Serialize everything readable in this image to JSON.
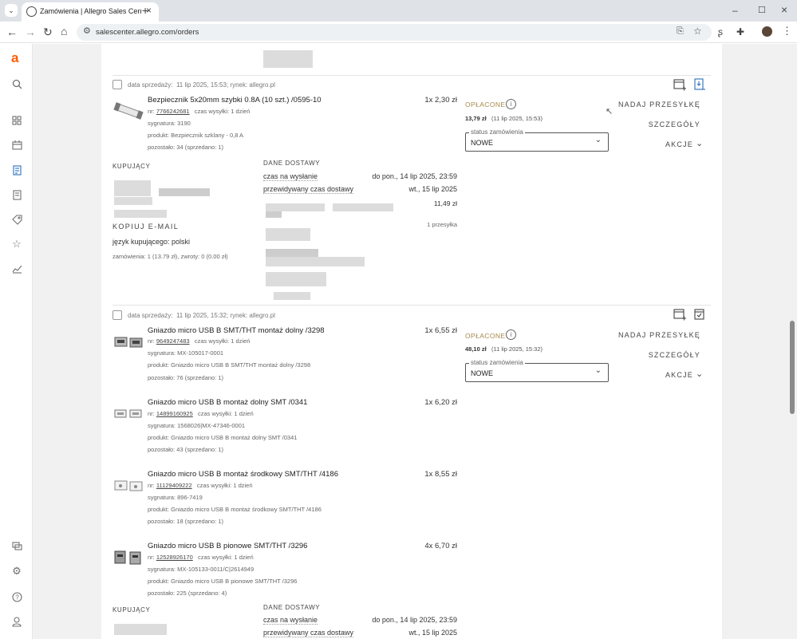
{
  "browser": {
    "tab_title": "Zamówienia | Allegro Sales Center",
    "url": "salescenter.allegro.com/orders"
  },
  "sidebar": {
    "logo": "a",
    "items": [
      "search-icon",
      "dashboard-icon",
      "calendar-icon",
      "orders-icon",
      "catalog-icon",
      "tag-icon",
      "star-icon",
      "stats-icon",
      "messages-icon",
      "settings-icon",
      "help-icon",
      "user-icon"
    ]
  },
  "orders": [
    {
      "sale_date_label": "data sprzedaży:",
      "sale_date": "11 lip 2025, 15:53; rynek: allegro.pl",
      "items": [
        {
          "name": "Bezpiecznik 5x20mm szybki 0.8A (10 szt.) /0595-10",
          "nr_label": "nr:",
          "nr": "7766242681",
          "ship_time": "czas wysyłki: 1 dzień",
          "signature": "sygnatura: 3190",
          "product": "produkt: Bezpiecznik szklany - 0,8 A",
          "remaining": "pozostało: 34 (sprzedano: 1)",
          "qty": "1x 2,30 zł"
        }
      ],
      "payment_status": "OPŁACONE",
      "total": "13,79 zł",
      "total_date": "(11 lip 2025, 15:53)",
      "status_label": "status zamówienia",
      "status_value": "NOWE",
      "actions": [
        "NADAJ PRZESYŁKĘ",
        "SZCZEGÓŁY",
        "AKCJE"
      ],
      "buyer_header": "KUPUJĄCY",
      "copy_email": "KOPIUJ E-MAIL",
      "buyer_language": "język kupującego: polski",
      "buyer_orders": "zamówienia: 1 (13.79 zł), zwroty: 0 (0.00 zł)",
      "delivery_header": "DANE DOSTAWY",
      "ship_by_label": "czas na wysłanie",
      "ship_by_value": "do pon., 14 lip 2025, 23:59",
      "eta_label": "przewidywany czas dostawy",
      "eta_value": "wt., 15 lip 2025",
      "delivery_cost": "11,49 zł",
      "parcels": "1 przesyłka"
    },
    {
      "sale_date_label": "data sprzedaży:",
      "sale_date": "11 lip 2025, 15:32; rynek: allegro.pl",
      "items": [
        {
          "name": "Gniazdo micro USB B SMT/THT montaż dolny /3298",
          "nr_label": "nr:",
          "nr": "9649247483",
          "ship_time": "czas wysyłki: 1 dzień",
          "signature": "sygnatura: MX-105017-0001",
          "product": "produkt: Gniazdo micro USB B SMT/THT montaż dolny /3298",
          "remaining": "pozostało: 76 (sprzedano: 1)",
          "qty": "1x 6,55 zł"
        },
        {
          "name": "Gniazdo micro USB B montaż dolny SMT /0341",
          "nr_label": "nr:",
          "nr": "14899160925",
          "ship_time": "czas wysyłki: 1 dzień",
          "signature": "sygnatura: 1568026|MX-47346-0001",
          "product": "produkt: Gniazdo micro USB B montaż dolny SMT /0341",
          "remaining": "pozostało: 43 (sprzedano: 1)",
          "qty": "1x 6,20 zł"
        },
        {
          "name": "Gniazdo micro USB B montaż środkowy SMT/THT /4186",
          "nr_label": "nr:",
          "nr": "11129409222",
          "ship_time": "czas wysyłki: 1 dzień",
          "signature": "sygnatura: 896-7419",
          "product": "produkt: Gniazdo micro USB B montaż środkowy SMT/THT /4186",
          "remaining": "pozostało: 18 (sprzedano: 1)",
          "qty": "1x 8,55 zł"
        },
        {
          "name": "Gniazdo micro USB B pionowe SMT/THT /3296",
          "nr_label": "nr:",
          "nr": "12528926170",
          "ship_time": "czas wysyłki: 1 dzień",
          "signature": "sygnatura: MX-105133-0011/C|2614949",
          "product": "produkt: Gniazdo micro USB B pionowe SMT/THT /3296",
          "remaining": "pozostało: 225 (sprzedano: 4)",
          "qty": "4x 6,70 zł"
        }
      ],
      "payment_status": "OPŁACONE",
      "total": "48,10 zł",
      "total_date": "(11 lip 2025, 15:32)",
      "status_label": "status zamówienia",
      "status_value": "NOWE",
      "actions": [
        "NADAJ PRZESYŁKĘ",
        "SZCZEGÓŁY",
        "AKCJE"
      ],
      "buyer_header": "KUPUJĄCY",
      "delivery_header": "DANE DOSTAWY",
      "ship_by_label": "czas na wysłanie",
      "ship_by_value": "do pon., 14 lip 2025, 23:59",
      "eta_label": "przewidywany czas dostawy",
      "eta_value": "wt., 15 lip 2025"
    }
  ]
}
